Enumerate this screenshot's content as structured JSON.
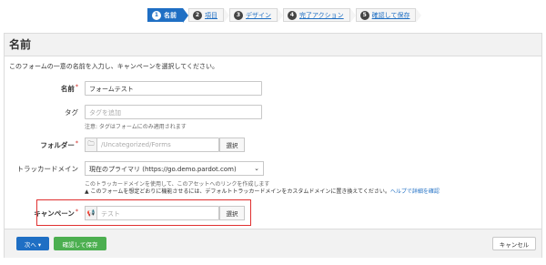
{
  "wizard": {
    "steps": [
      {
        "num": "1",
        "label": "名前"
      },
      {
        "num": "2",
        "label": "項目"
      },
      {
        "num": "3",
        "label": "デザイン"
      },
      {
        "num": "4",
        "label": "完了アクション"
      },
      {
        "num": "5",
        "label": "確認して保存"
      }
    ]
  },
  "panel": {
    "title": "名前",
    "description": "このフォームの一意の名前を入力し、キャンペーンを選択してください。"
  },
  "form": {
    "name_label": "名前",
    "name_value": "フォームテスト",
    "tag_label": "タグ",
    "tag_placeholder": "タグを追加",
    "tag_help": "注意: タグはフォームにのみ適用されます",
    "folder_label": "フォルダー",
    "folder_value": "/Uncategorized/Forms",
    "folder_select": "選択",
    "tracker_label": "トラッカードメイン",
    "tracker_value": "現在のプライマリ (https://go.demo.pardot.com)",
    "tracker_help": "このトラッカードメインを使用して、このアセットへのリンクを作成します",
    "tracker_warning": "このフォームを想定どおりに機能させるには、デフォルトトラッカードメインをカスタムドメインに置き換えてください。",
    "tracker_warning_link": "ヘルプで詳細を確認",
    "campaign_label": "キャンペーン",
    "campaign_placeholder": "テスト",
    "campaign_select": "選択"
  },
  "footer": {
    "next_label": "次へ ▾",
    "save_label": "確認して保存",
    "cancel_label": "キャンセル"
  },
  "colors": {
    "accent": "#1f6fc4",
    "success": "#4caf50",
    "highlight": "#e03030"
  }
}
